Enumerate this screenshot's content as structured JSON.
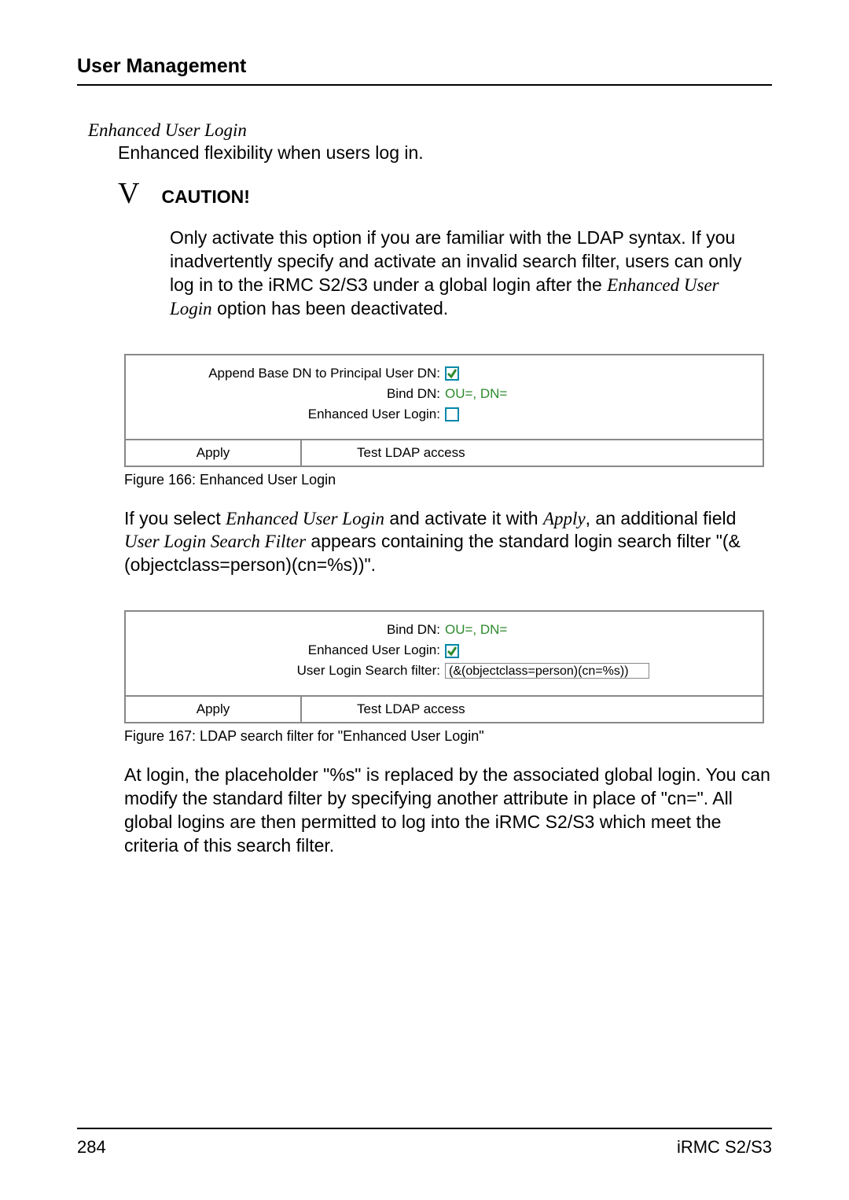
{
  "header": {
    "section_title": "User Management"
  },
  "subsection": {
    "title": "Enhanced User Login",
    "desc": "Enhanced flexibility when users log in."
  },
  "caution": {
    "marker": "V",
    "label": "CAUTION!",
    "text_before": "Only activate this option if you are familiar with the LDAP syntax. If you inadvertently specify and activate an invalid search filter, users can only log in to the iRMC S2/S3 under a global login after the ",
    "text_italic": "Enhanced User Login",
    "text_after": " option has been deactivated."
  },
  "figure166": {
    "rows": {
      "append_label": "Append Base DN to Principal User DN:",
      "append_checked": true,
      "bind_label": "Bind DN:",
      "bind_value": "OU=, DN=",
      "enhanced_label": "Enhanced User Login:",
      "enhanced_checked": false
    },
    "buttons": {
      "apply": "Apply",
      "test": "Test LDAP access"
    },
    "caption": "Figure 166:  Enhanced User Login"
  },
  "paragraph1": {
    "p1": "If you select ",
    "i1": "Enhanced User Login",
    "p2": " and activate it with ",
    "i2": "Apply",
    "p3": ", an additional field ",
    "i3": "User Login Search Filter",
    "p4": " appears containing the standard login search filter \"(&(objectclass=person)(cn=%s))\"."
  },
  "figure167": {
    "rows": {
      "bind_label": "Bind DN:",
      "bind_value": "OU=, DN=",
      "enhanced_label": "Enhanced User Login:",
      "enhanced_checked": true,
      "filter_label": "User Login Search filter:",
      "filter_value": "(&(objectclass=person)(cn=%s))"
    },
    "buttons": {
      "apply": "Apply",
      "test": "Test LDAP access"
    },
    "caption": "Figure 167: LDAP search filter for \"Enhanced User Login\""
  },
  "paragraph2": {
    "text": "At login, the placeholder \"%s\" is replaced by the associated global login. You can modify the standard filter by specifying another attribute in place of \"cn=\". All global logins are then permitted to log into the iRMC S2/S3 which meet the criteria of this search filter."
  },
  "footer": {
    "page": "284",
    "doc": "iRMC S2/S3"
  }
}
